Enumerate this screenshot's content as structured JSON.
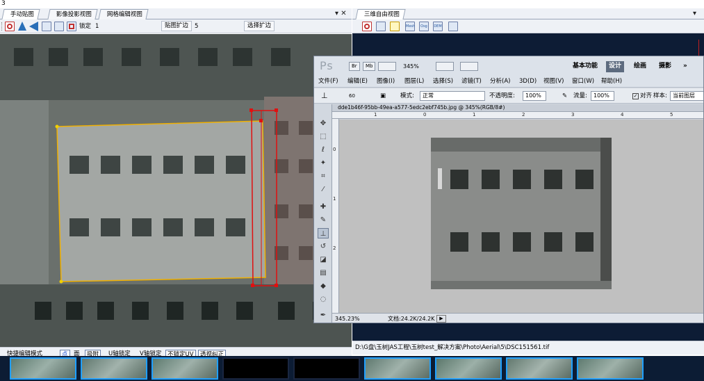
{
  "top_label": "3",
  "left_pane": {
    "tabs": [
      "手动贴图",
      "影像投影视图",
      "网格编辑视图"
    ],
    "controls": "▾ ✕",
    "toolbar": {
      "lock_label": "锁定",
      "lock_value": "1",
      "texture_expand_label": "贴图扩边",
      "texture_expand_value": "5",
      "select_expand_label": "选择扩边"
    },
    "statusbar": {
      "items": [
        "快捷编辑模式",
        "点",
        "面",
        "吸附",
        "U轴锁定",
        "V轴锁定",
        "不锁定UV",
        "透视纠正"
      ]
    }
  },
  "right_pane": {
    "tab": "三维自由视图",
    "control": "▾",
    "toolbar_icons": [
      "camera-icon",
      "select-icon",
      "sun-icon",
      "mesh-icon",
      "osg-icon",
      "dem-icon",
      "export-icon"
    ],
    "mesh_label": "Mesh",
    "osg_label": "Osg",
    "dem_label": "DEM",
    "status_path": "D:\\G盘\\玉树JAS工程\\玉树test_解决方案\\Photo\\Aerial\\5\\DSC151561.tif"
  },
  "photoshop": {
    "logo": "Ps",
    "br": "Br",
    "mb": "Mb",
    "zoom": "345%",
    "workspaces": [
      "基本功能",
      "设计",
      "绘画",
      "摄影"
    ],
    "active_workspace": "设计",
    "more": "»",
    "menus": [
      "文件(F)",
      "编辑(E)",
      "图像(I)",
      "图层(L)",
      "选择(S)",
      "滤镜(T)",
      "分析(A)",
      "3D(D)",
      "视图(V)",
      "窗口(W)",
      "帮助(H)"
    ],
    "options": {
      "brush_size": "60",
      "mode_label": "模式:",
      "mode_value": "正常",
      "opacity_label": "不透明度:",
      "opacity_value": "100%",
      "flow_label": "流量:",
      "flow_value": "100%",
      "align_label": "对齐",
      "sample_label": "样本:",
      "sample_value": "当前图层"
    },
    "doc_tab": "dde1b46f-95bb-49ea-a577-5edc2ebf745b.jpg @ 345%(RGB/8#)",
    "ruler_h": [
      "1",
      "0",
      "1",
      "2",
      "3",
      "4",
      "5"
    ],
    "ruler_v": [
      "0",
      "1",
      "2"
    ],
    "status_zoom": "345.23%",
    "status_doc": "文档:24.2K/24.2K"
  },
  "colors": {
    "accent_blue": "#1fa0ff",
    "frame_red": "#e01010",
    "frame_yellow": "#f0b000",
    "ps_active_ws": "#5d6b7f"
  }
}
